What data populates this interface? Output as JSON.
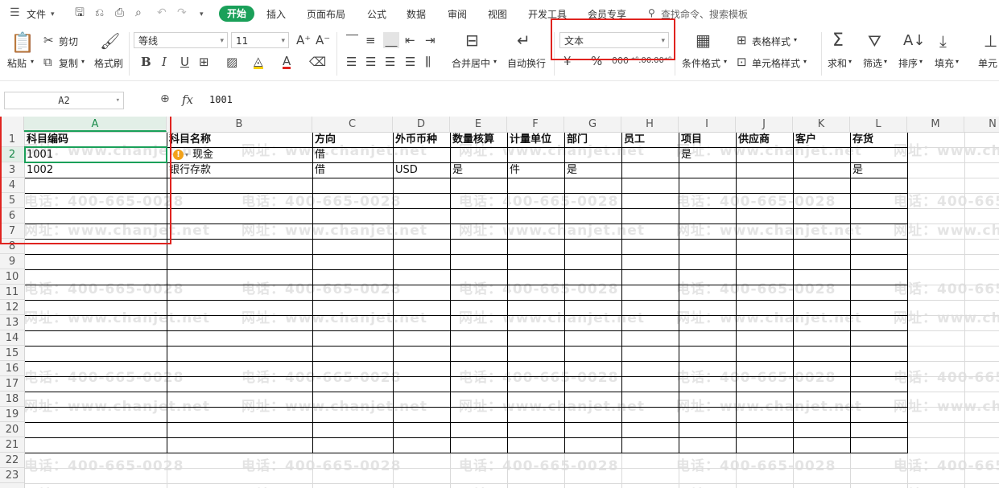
{
  "menu": {
    "file": "文件",
    "tabs": [
      "开始",
      "插入",
      "页面布局",
      "公式",
      "数据",
      "审阅",
      "视图",
      "开发工具",
      "会员专享"
    ],
    "search_placeholder": "查找命令、搜索模板"
  },
  "ribbon": {
    "paste": "粘贴",
    "cut": "剪切",
    "copy": "复制",
    "format_painter": "格式刷",
    "font_name": "等线",
    "font_size": "11",
    "merge_center": "合并居中",
    "wrap_text": "自动换行",
    "number_format": "文本",
    "conditional_format": "条件格式",
    "table_style": "表格样式",
    "cell_style": "单元格样式",
    "sum": "求和",
    "filter": "筛选",
    "sort": "排序",
    "fill": "填充",
    "cell": "单元"
  },
  "formula_bar": {
    "name_box": "A2",
    "fx": "fx",
    "value": "1001"
  },
  "columns": [
    "A",
    "B",
    "C",
    "D",
    "E",
    "F",
    "G",
    "H",
    "I",
    "J",
    "K",
    "L",
    "M",
    "N"
  ],
  "rows": [
    "1",
    "2",
    "3",
    "4",
    "5",
    "6",
    "7",
    "8",
    "9",
    "10",
    "11",
    "12",
    "13",
    "14",
    "15",
    "16",
    "17",
    "18",
    "19",
    "20",
    "21",
    "22",
    "23"
  ],
  "sheet": {
    "headers": [
      "科目编码",
      "科目名称",
      "方向",
      "外币币种",
      "数量核算",
      "计量单位",
      "部门",
      "员工",
      "项目",
      "供应商",
      "客户",
      "存货"
    ],
    "row2": [
      "1001",
      "现金",
      "借",
      "",
      "",
      "",
      "",
      "",
      "是",
      "",
      "",
      ""
    ],
    "row3": [
      "1002",
      "银行存款",
      "借",
      "USD",
      "是",
      "件",
      "是",
      "",
      "",
      "",
      "",
      "是"
    ]
  },
  "watermark": {
    "phone": "电话：400-665-0028",
    "site": "网址：www.chanjet.net"
  },
  "colors": {
    "accent": "#1aa059",
    "highlight": "#e0231f",
    "warning": "#f2a21a"
  }
}
